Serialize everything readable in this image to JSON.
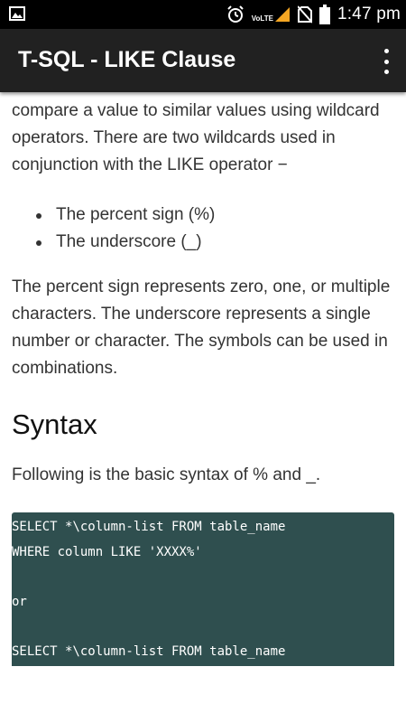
{
  "status_bar": {
    "time": "1:47 pm",
    "network_label": "VoLTE",
    "icons": [
      "image-icon",
      "alarm-icon",
      "signal-icon",
      "no-sim-icon",
      "battery-icon"
    ]
  },
  "app_bar": {
    "title": "T-SQL - LIKE Clause",
    "menu_icon": "more-vert-icon"
  },
  "content": {
    "intro": "compare a value to similar values using wildcard operators. There are two wildcards used in conjunction with the LIKE operator −",
    "bullets": [
      "The percent sign (%)",
      "The underscore (_)"
    ],
    "description": "The percent sign represents zero, one, or multiple characters. The underscore represents a single number or character. The symbols can be used in combinations.",
    "syntax_heading": "Syntax",
    "syntax_intro": "Following is the basic syntax of % and _.",
    "code_lines": [
      "SELECT *\\column-list FROM table_name",
      "WHERE column LIKE 'XXXX%'",
      "",
      "or",
      "",
      "SELECT *\\column-list FROM table_name"
    ]
  },
  "colors": {
    "status_bar": "#000000",
    "app_bar": "#212121",
    "code_background": "#2f4f4f",
    "body_text": "#333333"
  }
}
